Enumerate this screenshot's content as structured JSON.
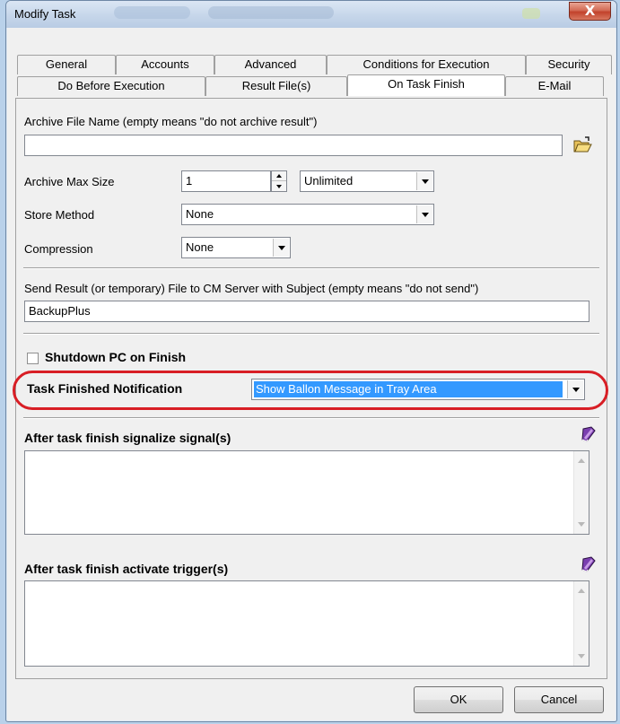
{
  "window": {
    "title": "Modify Task",
    "close_glyph": "X"
  },
  "tabs": {
    "row1": [
      "General",
      "Accounts",
      "Advanced",
      "Conditions for Execution",
      "Security"
    ],
    "row2": [
      "Do Before Execution",
      "Result File(s)",
      "On Task Finish",
      "E-Mail"
    ],
    "active": "On Task Finish"
  },
  "archive": {
    "file_label": "Archive File Name (empty means \"do not archive result\")",
    "file_value": "",
    "max_size_label": "Archive Max Size",
    "max_size_value": "1",
    "max_size_unit": "Unlimited",
    "store_method_label": "Store Method",
    "store_method_value": "None",
    "compression_label": "Compression",
    "compression_value": "None"
  },
  "send_result": {
    "label": "Send Result (or temporary) File to CM Server with Subject (empty means \"do not send\")",
    "value": "BackupPlus"
  },
  "shutdown": {
    "label": "Shutdown PC on Finish",
    "checked": false
  },
  "notification": {
    "label": "Task Finished Notification",
    "value": "Show Ballon Message in Tray Area"
  },
  "signals": {
    "label": "After task finish signalize signal(s)"
  },
  "triggers": {
    "label": "After task finish activate trigger(s)"
  },
  "buttons": {
    "ok": "OK",
    "cancel": "Cancel"
  },
  "colors": {
    "highlight": "#d81e25",
    "selection": "#3399ff"
  },
  "icons": [
    "close-icon",
    "folder-open-icon",
    "book-icon",
    "chevron-down-icon",
    "spin-up-icon",
    "spin-down-icon"
  ]
}
